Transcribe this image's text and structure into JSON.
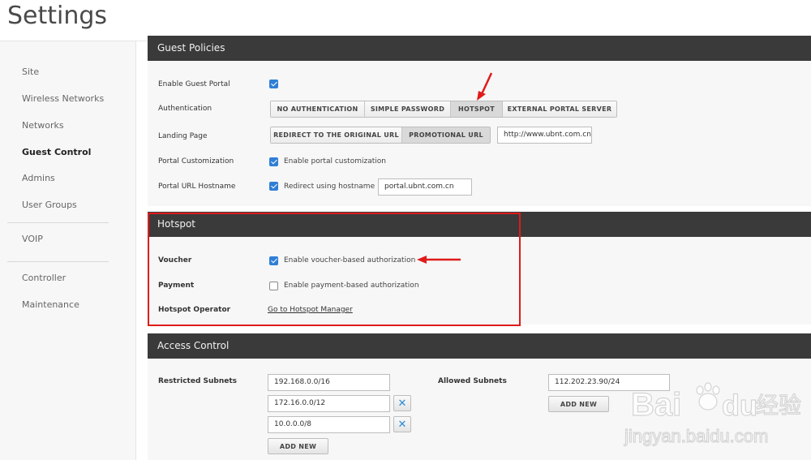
{
  "page": {
    "title": "Settings"
  },
  "sidebar": {
    "items": [
      {
        "label": "Site"
      },
      {
        "label": "Wireless Networks"
      },
      {
        "label": "Networks"
      },
      {
        "label": "Guest Control",
        "active": true
      },
      {
        "label": "Admins"
      },
      {
        "label": "User Groups"
      },
      {
        "label": "VOIP"
      },
      {
        "label": "Controller"
      },
      {
        "label": "Maintenance"
      }
    ]
  },
  "guest_policies": {
    "title": "Guest Policies",
    "enable_portal_label": "Enable Guest Portal",
    "enable_portal_checked": true,
    "auth_label": "Authentication",
    "auth_options": [
      "NO AUTHENTICATION",
      "SIMPLE PASSWORD",
      "HOTSPOT",
      "EXTERNAL PORTAL SERVER"
    ],
    "auth_selected": "HOTSPOT",
    "landing_label": "Landing Page",
    "landing_options": [
      "REDIRECT TO THE ORIGINAL URL",
      "PROMOTIONAL URL"
    ],
    "landing_selected": "PROMOTIONAL URL",
    "landing_url": "http://www.ubnt.com.cn",
    "customization_label": "Portal Customization",
    "customization_text": "Enable portal customization",
    "customization_checked": true,
    "hostname_label": "Portal URL Hostname",
    "hostname_text": "Redirect using hostname",
    "hostname_checked": true,
    "hostname_value": "portal.ubnt.com.cn"
  },
  "hotspot": {
    "title": "Hotspot",
    "voucher_label": "Voucher",
    "voucher_text": "Enable voucher-based authorization",
    "voucher_checked": true,
    "payment_label": "Payment",
    "payment_text": "Enable payment-based authorization",
    "payment_checked": false,
    "operator_label": "Hotspot Operator",
    "operator_link": "Go to Hotspot Manager"
  },
  "access_control": {
    "title": "Access Control",
    "restricted_label": "Restricted Subnets",
    "restricted_subnets": [
      "192.168.0.0/16",
      "172.16.0.0/12",
      "10.0.0.0/8"
    ],
    "allowed_label": "Allowed Subnets",
    "allowed_subnets": [
      "112.202.23.90/24"
    ],
    "add_new_label": "ADD NEW",
    "remove_icon": "close-icon"
  },
  "colors": {
    "accent": "#2f7fd6",
    "highlight": "#e01b1b",
    "header": "#3a3a3a"
  }
}
